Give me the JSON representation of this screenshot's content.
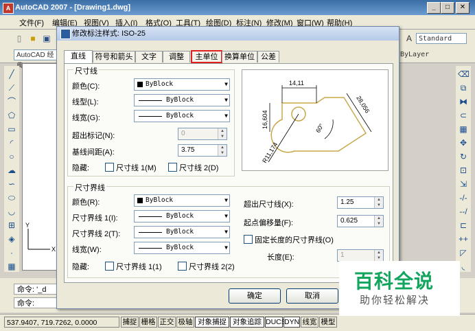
{
  "app": {
    "title": "AutoCAD 2007 - [Drawing1.dwg]"
  },
  "menubar": [
    "文件(F)",
    "编辑(E)",
    "视图(V)",
    "插入(I)",
    "格式(O)",
    "工具(T)",
    "绘图(D)",
    "标注(N)",
    "修改(M)",
    "窗口(W)",
    "帮助(H)"
  ],
  "toolbar": {
    "workspace_combo": "AutoCAD 经典",
    "text_style_combo": "Standard",
    "layer_combo": "ByLayer"
  },
  "dialog": {
    "title": "修改标注样式: ISO-25",
    "tabs": [
      "直线",
      "符号和箭头",
      "文字",
      "调整",
      "主单位",
      "换算单位",
      "公差"
    ],
    "active_tab": "直线",
    "highlighted_tab": "主单位",
    "dim_lines": {
      "group_title": "尺寸线",
      "color_label": "颜色(C):",
      "color_value": "ByBlock",
      "linetype_label": "线型(L):",
      "linetype_value": "ByBlock",
      "lineweight_label": "线宽(G):",
      "lineweight_value": "ByBlock",
      "extend_ticks_label": "超出标记(N):",
      "extend_ticks_value": "0",
      "baseline_spacing_label": "基线间距(A):",
      "baseline_spacing_value": "3.75",
      "suppress_label": "隐藏:",
      "suppress_1": "尺寸线 1(M)",
      "suppress_2": "尺寸线 2(D)"
    },
    "ext_lines": {
      "group_title": "尺寸界线",
      "color_label": "颜色(R):",
      "color_value": "ByBlock",
      "linetype1_label": "尺寸界线 1(I):",
      "linetype1_value": "ByBlock",
      "linetype2_label": "尺寸界线 2(T):",
      "linetype2_value": "ByBlock",
      "lineweight_label": "线宽(W):",
      "lineweight_value": "ByBlock",
      "suppress_label": "隐藏:",
      "suppress_1": "尺寸界线 1(1)",
      "suppress_2": "尺寸界线 2(2)",
      "extend_beyond_label": "超出尺寸线(X):",
      "extend_beyond_value": "1.25",
      "offset_origin_label": "起点偏移量(F):",
      "offset_origin_value": "0.625",
      "fixed_length_label": "固定长度的尺寸界线(O)",
      "length_label": "长度(E):",
      "length_value": "1"
    },
    "preview": {
      "dims": [
        "14,11",
        "16,604",
        "28,056",
        "60°",
        "R11,174"
      ]
    },
    "ok_label": "确定",
    "cancel_label": "取消"
  },
  "command": {
    "line1": "命令: '_d",
    "line2": "命令:"
  },
  "status": {
    "coords": "537.9407, 719.7262, 0.0000",
    "buttons": [
      "捕捉",
      "栅格",
      "正交",
      "极轴",
      "对象捕捉",
      "对象追踪",
      "DUCS",
      "DYN",
      "线宽",
      "模型"
    ]
  },
  "watermark": {
    "brand": "百科全说",
    "tagline": "助你轻松解决"
  }
}
